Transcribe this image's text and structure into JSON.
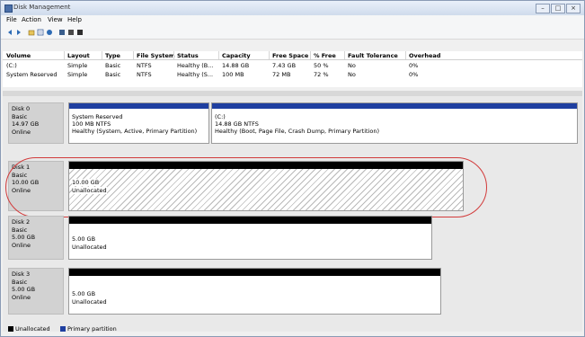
{
  "window": {
    "title": "Disk Management",
    "min": "–",
    "max": "□",
    "close": "×"
  },
  "menu": [
    "File",
    "Action",
    "View",
    "Help"
  ],
  "toolbar": [
    "back-icon",
    "forward-icon",
    "up-icon",
    "properties-icon",
    "help-icon",
    "refresh-icon",
    "settings-icon",
    "list-icon"
  ],
  "columns": [
    "Volume",
    "Layout",
    "Type",
    "File System",
    "Status",
    "Capacity",
    "Free Space",
    "% Free",
    "Fault Tolerance",
    "Overhead"
  ],
  "volumes": [
    {
      "volume": "(C:)",
      "layout": "Simple",
      "type": "Basic",
      "fs": "NTFS",
      "status": "Healthy (B...",
      "capacity": "14.88 GB",
      "free": "7.43 GB",
      "pct": "50 %",
      "fault": "No",
      "overhead": "0%"
    },
    {
      "volume": "System Reserved",
      "layout": "Simple",
      "type": "Basic",
      "fs": "NTFS",
      "status": "Healthy (S...",
      "capacity": "100 MB",
      "free": "72 MB",
      "pct": "72 %",
      "fault": "No",
      "overhead": "0%"
    }
  ],
  "disks": [
    {
      "name": "Disk 0",
      "type": "Basic",
      "size": "14.97 GB",
      "state": "Online",
      "parts": [
        {
          "title": "System Reserved",
          "size": "100 MB NTFS",
          "status": "Healthy (System, Active, Primary Partition)"
        },
        {
          "title": "(C:)",
          "size": "14.88 GB NTFS",
          "status": "Healthy (Boot, Page File, Crash Dump, Primary Partition)"
        }
      ]
    },
    {
      "name": "Disk 1",
      "type": "Basic",
      "size": "10.00 GB",
      "state": "Online",
      "parts": [
        {
          "title": "",
          "size": "10.00 GB",
          "status": "Unallocated"
        }
      ]
    },
    {
      "name": "Disk 2",
      "type": "Basic",
      "size": "5.00 GB",
      "state": "Online",
      "parts": [
        {
          "title": "",
          "size": "5.00 GB",
          "status": "Unallocated"
        }
      ]
    },
    {
      "name": "Disk 3",
      "type": "Basic",
      "size": "5.00 GB",
      "state": "Online",
      "parts": [
        {
          "title": "",
          "size": "5.00 GB",
          "status": "Unallocated"
        }
      ]
    }
  ],
  "legend": [
    {
      "label": "Unallocated",
      "color": "#000000"
    },
    {
      "label": "Primary partition",
      "color": "#1f3fa0"
    }
  ],
  "colors": {
    "primary": "#1f3fa0",
    "unallocated": "#000000",
    "highlight": "#d23b3b"
  }
}
